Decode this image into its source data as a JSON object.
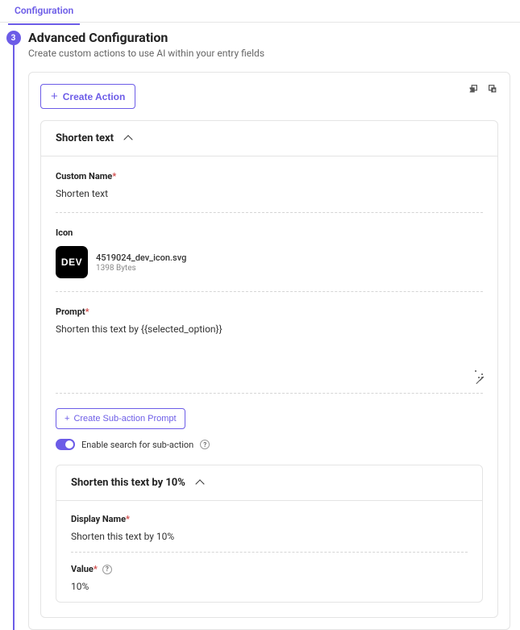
{
  "tab": {
    "label": "Configuration"
  },
  "step": {
    "number": "3"
  },
  "header": {
    "title": "Advanced Configuration",
    "subtitle": "Create custom actions to use AI within your entry fields"
  },
  "card": {
    "create_action_label": "Create Action"
  },
  "action": {
    "title": "Shorten text",
    "custom_name_label": "Custom Name",
    "custom_name_value": "Shorten text",
    "icon_label": "Icon",
    "icon_file_name": "4519024_dev_icon.svg",
    "icon_file_size": "1398 Bytes",
    "prompt_label": "Prompt",
    "prompt_value": "Shorten this text by {{selected_option}}",
    "create_subaction_label": "Create Sub-action Prompt",
    "enable_search_label": "Enable search for sub-action"
  },
  "subaction": {
    "title": "Shorten this text by 10%",
    "display_name_label": "Display Name",
    "display_name_value": "Shorten this text by 10%",
    "value_label": "Value",
    "value_value": "10%"
  }
}
